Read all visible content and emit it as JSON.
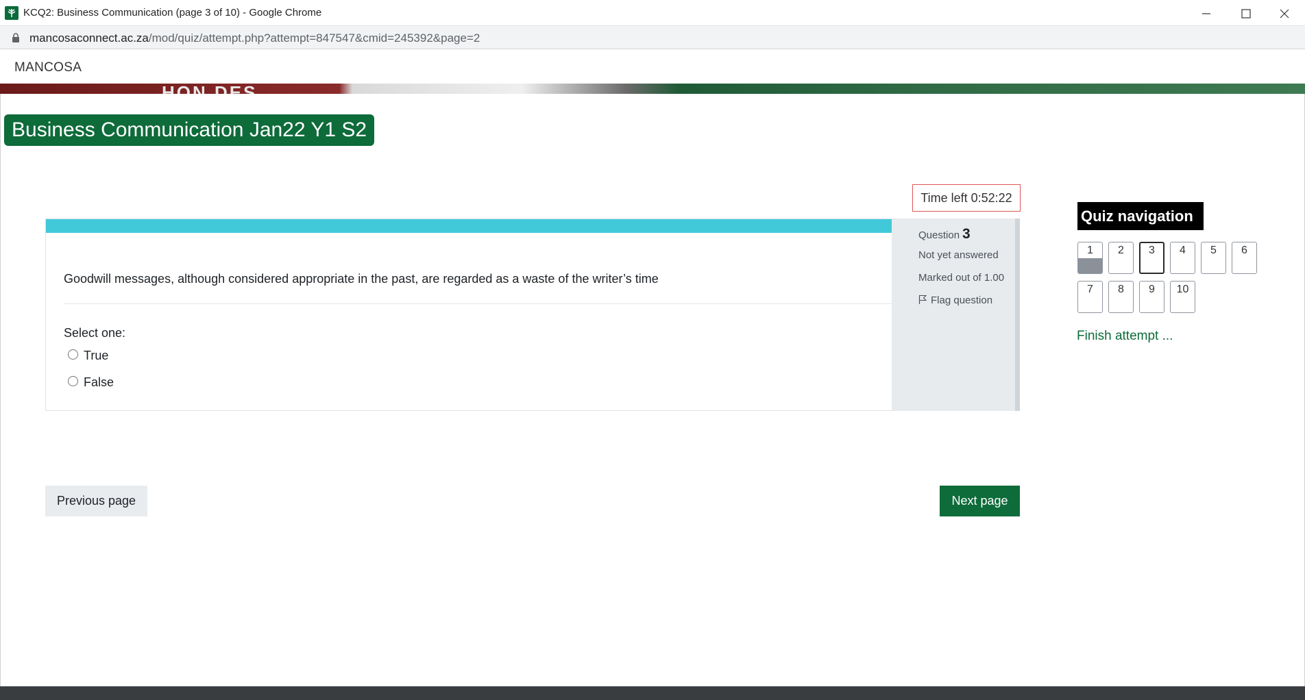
{
  "window": {
    "title": "KCQ2: Business Communication (page 3 of 10) - Google Chrome",
    "url_host": "mancosaconnect.ac.za",
    "url_path": "/mod/quiz/attempt.php?attempt=847547&cmid=245392&page=2"
  },
  "site": {
    "brand": "MANCOSA",
    "banner_text": "HON   DES",
    "course_title": "Business Communication Jan22 Y1 S2"
  },
  "timer": {
    "label": "Time left 0:52:22"
  },
  "question": {
    "label": "Question",
    "number": "3",
    "status": "Not yet answered",
    "marks": "Marked out of 1.00",
    "flag_label": "Flag question",
    "text": "Goodwill messages, although considered appropriate in the past, are regarded as a waste of the writer’s time",
    "select_label": "Select one:",
    "options": [
      "True",
      "False"
    ]
  },
  "navigation": {
    "previous_label": "Previous page",
    "next_label": "Next page"
  },
  "quiz_nav": {
    "title": "Quiz navigation",
    "buttons": [
      "1",
      "2",
      "3",
      "4",
      "5",
      "6",
      "7",
      "8",
      "9",
      "10"
    ],
    "current": "3",
    "answered": [
      "1"
    ],
    "finish_label": "Finish attempt ..."
  },
  "colors": {
    "brand_green": "#0e6b3a",
    "progress_cyan": "#42c9d9",
    "timer_border": "#e05555"
  }
}
